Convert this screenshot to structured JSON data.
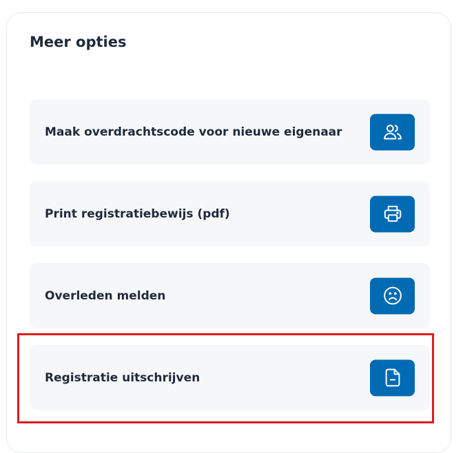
{
  "panel": {
    "title": "Meer opties"
  },
  "options": [
    {
      "label": "Maak overdrachtscode voor nieuwe eigenaar",
      "icon": "users-icon"
    },
    {
      "label": "Print registratiebewijs (pdf)",
      "icon": "printer-icon"
    },
    {
      "label": "Overleden melden",
      "icon": "sad-face-icon"
    },
    {
      "label": "Registratie uitschrijven",
      "icon": "file-minus-icon"
    }
  ],
  "colors": {
    "accent": "#006ab3",
    "option_background": "#f6f7f9",
    "text": "#1f2a3a",
    "highlight": "#e01b1b"
  }
}
